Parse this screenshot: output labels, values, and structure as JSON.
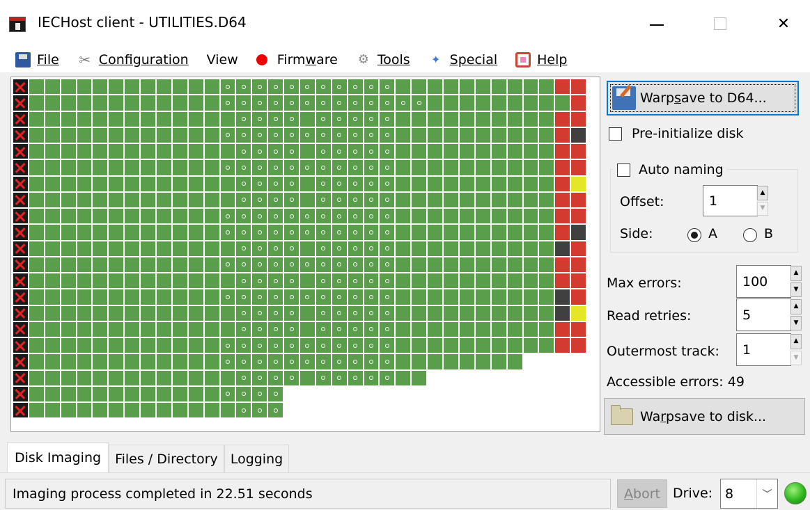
{
  "window": {
    "title": "IECHost client - UTILITIES.D64",
    "minimize_icon": "minimize-icon",
    "maximize_icon": "maximize-icon",
    "close_label": "✕"
  },
  "menu": {
    "file": "File",
    "configuration": "Configuration",
    "view": "View",
    "firmware_pre": "Firm",
    "firmware_u": "w",
    "firmware_post": "are",
    "tools": "Tools",
    "special": "Special",
    "help": "Help"
  },
  "sector_map": {
    "legend": {
      "g": "ok",
      "o": "ok-marked",
      "r": "error",
      "d": "dark-error",
      "y": "yellow-error",
      "x": "unreadable",
      "e": "empty"
    },
    "colors": {
      "ok": "#5a9e4c",
      "error": "#d33b31",
      "dark": "#404040",
      "yellow": "#e6e629",
      "unreadable": "#1a1a1a"
    },
    "rows": [
      "xggggggggggggoooooooooooggggggggggrrr",
      "xggggggggggggooooooooooooogggggggggrrr",
      "xgggggggggggggoooogoooooggggggggggrrr",
      "xggggggggggggoooooooooooggggggggggrdr",
      "xgggggggggggggoooogoooooggggggggggrrr",
      "xggggggggggggoooooooooooggggggggggrrr",
      "xgggggggggggggoooogoooooggggggggggryr",
      "xgggggggggggggoooogoooooggggggggggrrr",
      "xggggggggggggoooooooooooggggggggggrrr",
      "xggggggggggggoooooooooooggggggggggrdr",
      "xgggggggggggggoooogoooooggggggggggdrr",
      "xggggggggggggoooooooooooggggggggggrrr",
      "xgggggggggggggoooogoooooggggggggggrrr",
      "xggggggggggggoooooooooooggggggggggdrr",
      "xgggggggggggggoooogoooooggggggggggdyg",
      "xgggggggggggggoooogoooooggggggggggrrg",
      "xggggggggggggoooooooooooggggggggggrrr",
      "xggggggggggggoooooooooooggggggggeeeee",
      "xgggggggggggggoooogoooooggeeeeeeeeeee",
      "xggggggggggggooooeeeeeeeeeeeeeeeeeeee",
      "xgggggggggggggoooeeeeeeeeeeeeeeeeeeee"
    ]
  },
  "right_panel": {
    "warpsave_d64_pre": "Warp",
    "warpsave_d64_u": "s",
    "warpsave_d64_post": "ave to D64...",
    "preinit_label": "Pre-initialize disk",
    "auto_naming_label": "Auto naming",
    "offset_label": "Offset:",
    "offset_value": "1",
    "side_label": "Side:",
    "side_a": "A",
    "side_b": "B",
    "side_selected": "A",
    "max_errors_label": "Max errors:",
    "max_errors_value": "100",
    "read_retries_label": "Read retries:",
    "read_retries_value": "5",
    "outermost_track_label": "Outermost track:",
    "outermost_track_value": "1",
    "accessible_errors": "Accessible errors: 49",
    "warpsave_disk_pre": "Wa",
    "warpsave_disk_u": "r",
    "warpsave_disk_post": "psave to disk..."
  },
  "tabs": [
    {
      "label": "Disk Imaging",
      "active": true
    },
    {
      "label": "Files / Directory",
      "active": false
    },
    {
      "label": "Logging",
      "active": false
    }
  ],
  "status": {
    "message": "Imaging process completed in 22.51 seconds",
    "abort_pre": "",
    "abort_u": "A",
    "abort_post": "bort",
    "drive_label": "Drive:",
    "drive_value": "8",
    "led_color": "#2fb81e"
  }
}
